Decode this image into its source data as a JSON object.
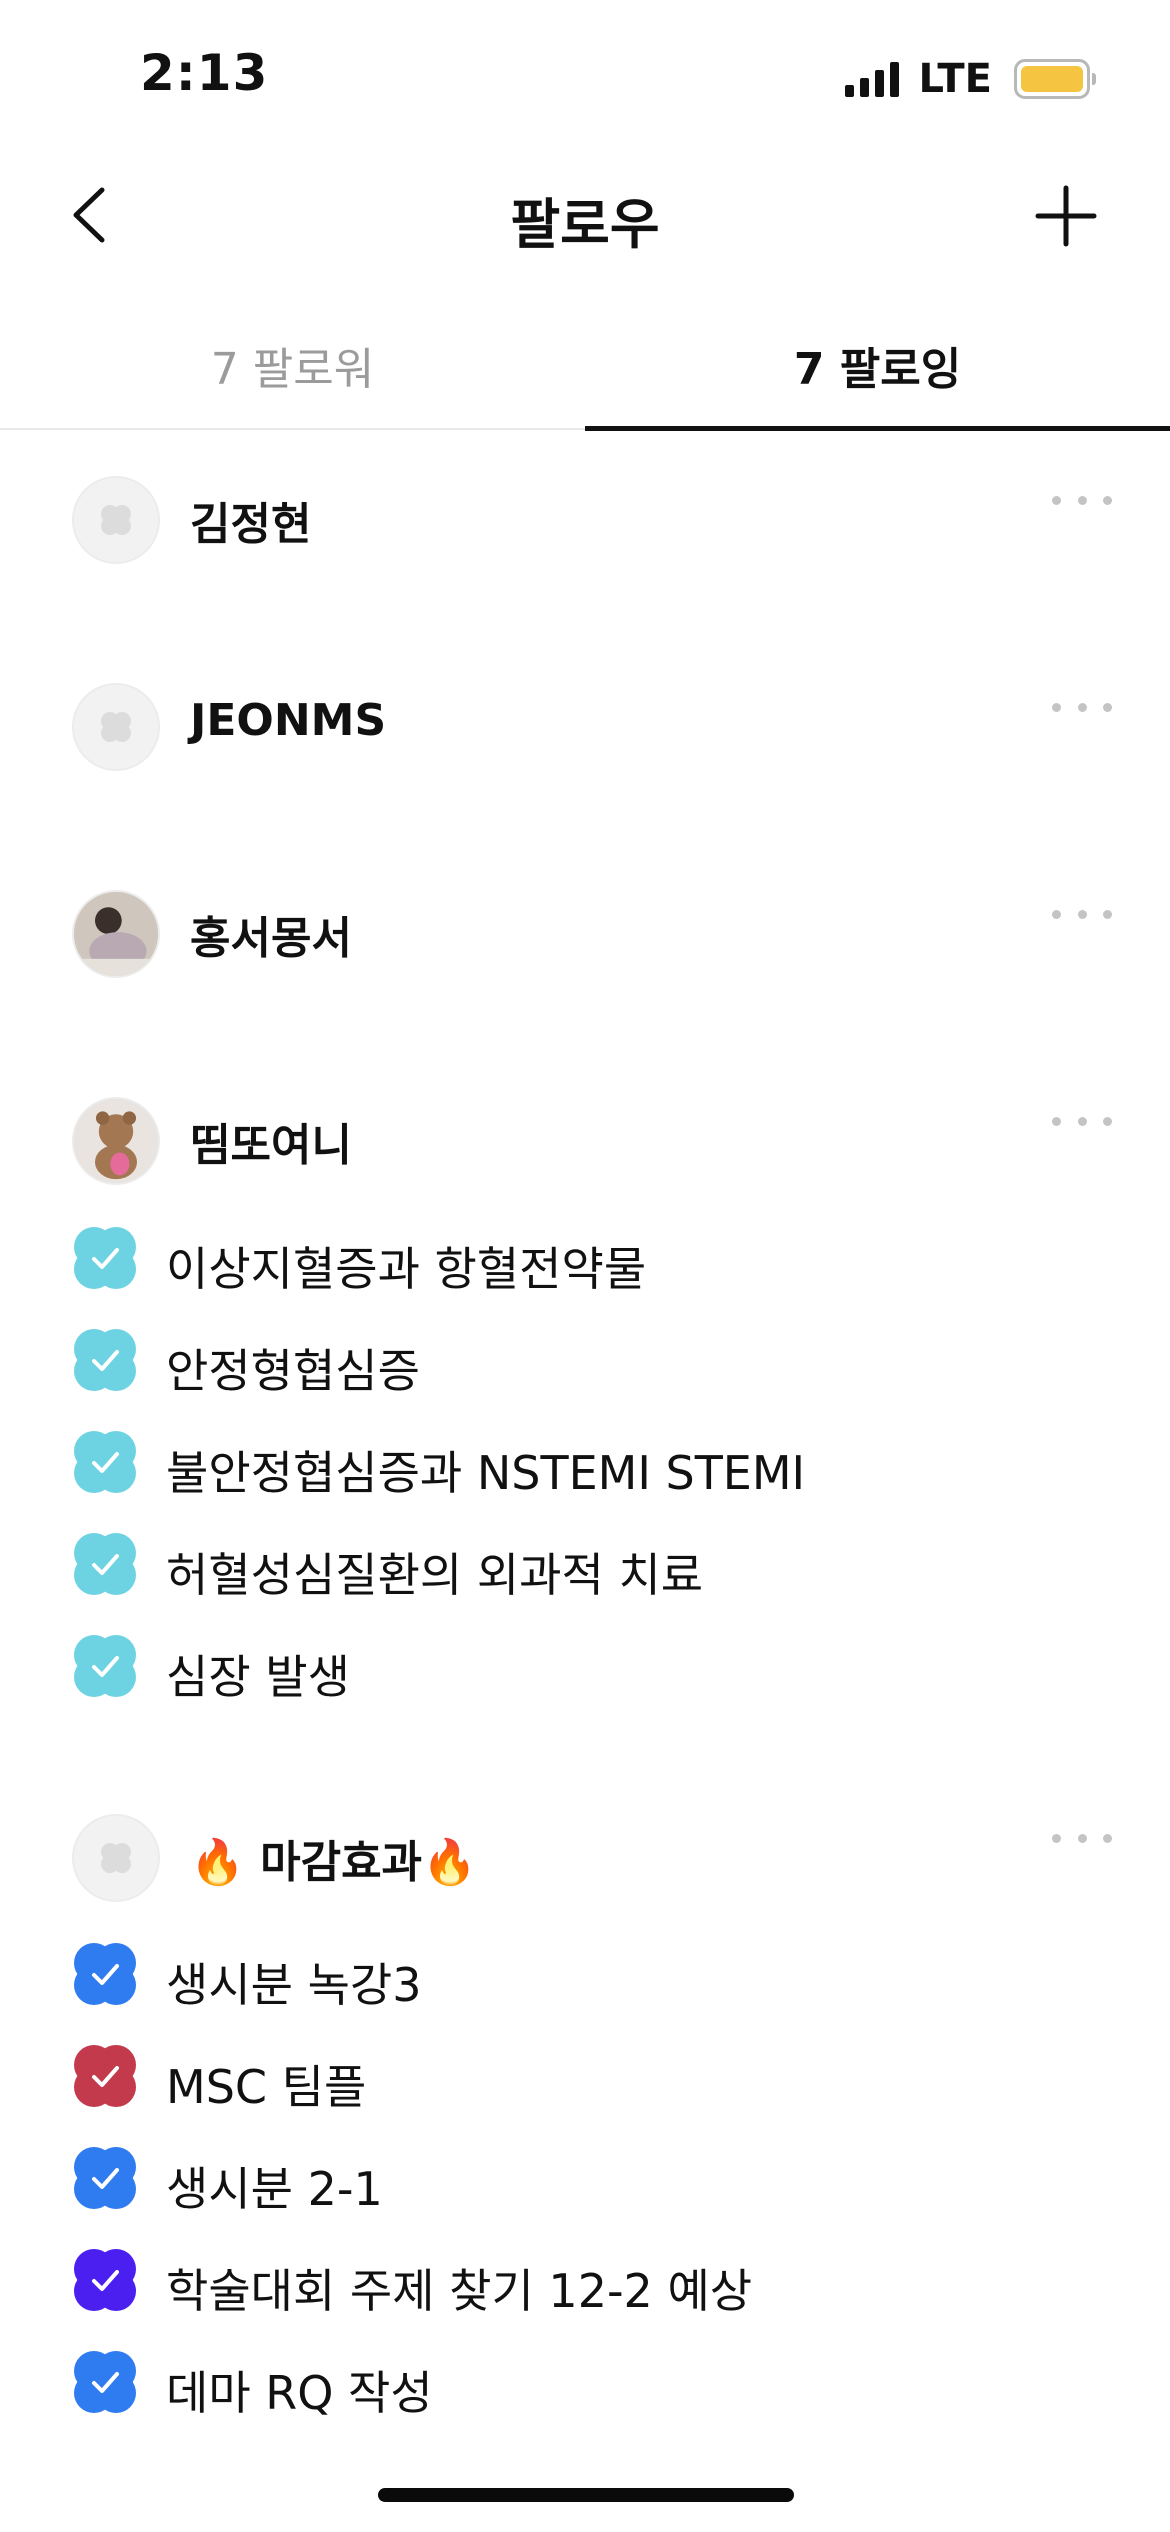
{
  "status_bar": {
    "time": "2:13",
    "network": "LTE",
    "battery_color": "#f5c542"
  },
  "nav": {
    "title": "팔로우",
    "back_icon": "chevron-left-icon",
    "add_icon": "plus-icon"
  },
  "tabs": [
    {
      "label": "7 팔로워",
      "selected": false
    },
    {
      "label": "7 팔로잉",
      "selected": true
    }
  ],
  "colors": {
    "teal": "#6dd3e2",
    "blue": "#2f7bf0",
    "crimson": "#c23a4c",
    "violet": "#4a1ff0"
  },
  "users": [
    {
      "name": "김정현",
      "avatar": "default-avatar-icon",
      "tasks": []
    },
    {
      "name": "JEONMS",
      "avatar": "default-avatar-icon",
      "tasks": []
    },
    {
      "name": "홍서몽서",
      "avatar": "photo-avatar",
      "tasks": []
    },
    {
      "name": "띰또여니",
      "avatar": "photo-avatar",
      "tasks": [
        {
          "label": "이상지혈증과 항혈전약물",
          "color": "#6dd3e2",
          "done": true
        },
        {
          "label": "안정형협심증",
          "color": "#6dd3e2",
          "done": true
        },
        {
          "label": "불안정협심증과 NSTEMI STEMI",
          "color": "#6dd3e2",
          "done": true
        },
        {
          "label": "허혈성심질환의 외과적 치료",
          "color": "#6dd3e2",
          "done": true
        },
        {
          "label": "심장 발생",
          "color": "#6dd3e2",
          "done": true
        }
      ]
    },
    {
      "name": "🔥 마감효과🔥",
      "avatar": "default-avatar-icon",
      "tasks": [
        {
          "label": "생시분 녹강3",
          "color": "#2f7bf0",
          "done": true
        },
        {
          "label": "MSC 팀플",
          "color": "#c23a4c",
          "done": true
        },
        {
          "label": "생시분 2-1",
          "color": "#2f7bf0",
          "done": true
        },
        {
          "label": "학술대회 주제 찾기 12-2 예상",
          "color": "#4a1ff0",
          "done": true
        },
        {
          "label": "데마 RQ 작성",
          "color": "#2f7bf0",
          "done": true
        }
      ]
    }
  ]
}
